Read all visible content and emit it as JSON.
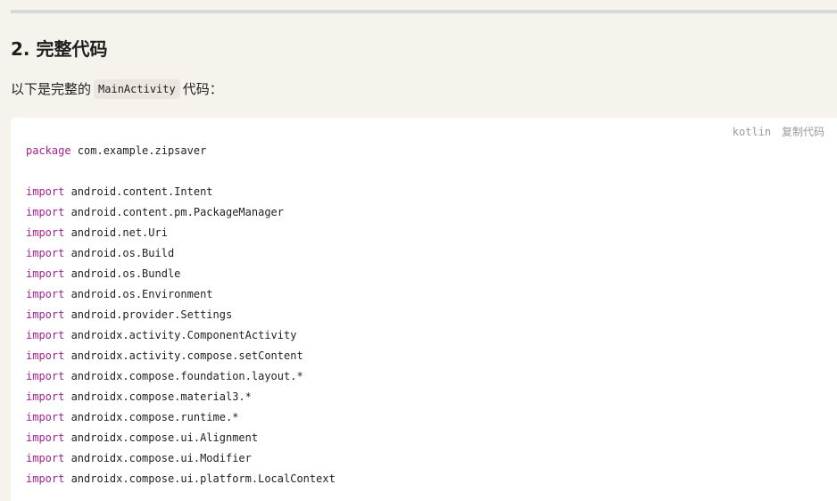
{
  "section": {
    "heading": "2. 完整代码",
    "intro_before": "以下是完整的",
    "intro_code": "MainActivity",
    "intro_after": "代码："
  },
  "code_block": {
    "language": "kotlin",
    "copy_label": "复制代码",
    "colors": {
      "keyword": "#a0238f",
      "background": "#ffffff",
      "page_background": "#f6f2ec"
    },
    "lines": [
      {
        "keyword": "package",
        "text": " com.example.zipsaver"
      },
      {
        "keyword": "",
        "text": ""
      },
      {
        "keyword": "import",
        "text": " android.content.Intent"
      },
      {
        "keyword": "import",
        "text": " android.content.pm.PackageManager"
      },
      {
        "keyword": "import",
        "text": " android.net.Uri"
      },
      {
        "keyword": "import",
        "text": " android.os.Build"
      },
      {
        "keyword": "import",
        "text": " android.os.Bundle"
      },
      {
        "keyword": "import",
        "text": " android.os.Environment"
      },
      {
        "keyword": "import",
        "text": " android.provider.Settings"
      },
      {
        "keyword": "import",
        "text": " androidx.activity.ComponentActivity"
      },
      {
        "keyword": "import",
        "text": " androidx.activity.compose.setContent"
      },
      {
        "keyword": "import",
        "text": " androidx.compose.foundation.layout.*"
      },
      {
        "keyword": "import",
        "text": " androidx.compose.material3.*"
      },
      {
        "keyword": "import",
        "text": " androidx.compose.runtime.*"
      },
      {
        "keyword": "import",
        "text": " androidx.compose.ui.Alignment"
      },
      {
        "keyword": "import",
        "text": " androidx.compose.ui.Modifier"
      },
      {
        "keyword": "import",
        "text": " androidx.compose.ui.platform.LocalContext"
      }
    ]
  }
}
